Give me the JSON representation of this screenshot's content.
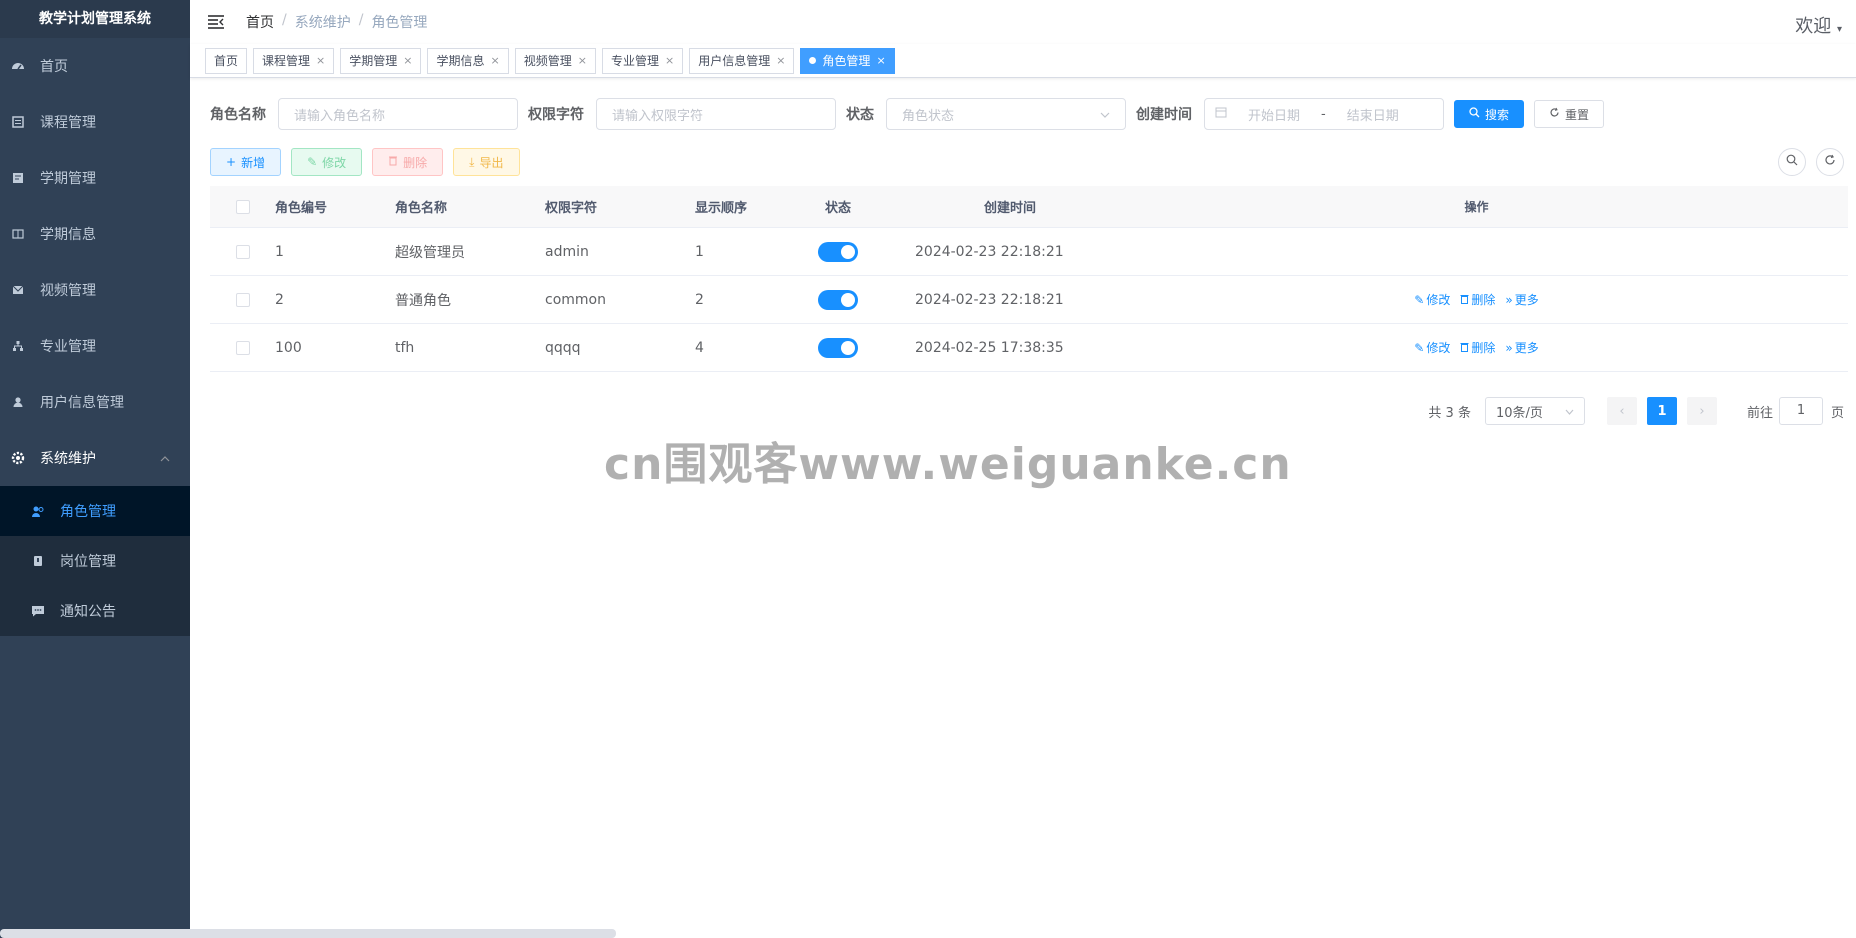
{
  "app": {
    "title": "教学计划管理系统"
  },
  "sidebar": {
    "items": [
      {
        "label": "首页",
        "icon": "dashboard-icon"
      },
      {
        "label": "课程管理",
        "icon": "list-icon"
      },
      {
        "label": "学期管理",
        "icon": "form-icon"
      },
      {
        "label": "学期信息",
        "icon": "table-icon"
      },
      {
        "label": "视频管理",
        "icon": "mail-icon"
      },
      {
        "label": "专业管理",
        "icon": "tree-icon"
      },
      {
        "label": "用户信息管理",
        "icon": "user-icon"
      },
      {
        "label": "系统维护",
        "icon": "gear-icon"
      }
    ],
    "submenu": [
      {
        "label": "角色管理",
        "icon": "peoples-icon"
      },
      {
        "label": "岗位管理",
        "icon": "post-icon"
      },
      {
        "label": "通知公告",
        "icon": "message-icon"
      }
    ]
  },
  "navbar": {
    "breadcrumb": [
      "首页",
      "系统维护",
      "角色管理"
    ],
    "separator": "/",
    "welcome": "欢迎"
  },
  "tags": [
    "首页",
    "课程管理",
    "学期管理",
    "学期信息",
    "视频管理",
    "专业管理",
    "用户信息管理",
    "角色管理"
  ],
  "search": {
    "role_name_label": "角色名称",
    "role_name_placeholder": "请输入角色名称",
    "role_key_label": "权限字符",
    "role_key_placeholder": "请输入权限字符",
    "status_label": "状态",
    "status_placeholder": "角色状态",
    "created_label": "创建时间",
    "start_placeholder": "开始日期",
    "range_sep": "-",
    "end_placeholder": "结束日期",
    "search_button": "搜索",
    "reset_button": "重置"
  },
  "toolbar": {
    "add": "新增",
    "edit": "修改",
    "delete": "删除",
    "export": "导出"
  },
  "table": {
    "headers": [
      "角色编号",
      "角色名称",
      "权限字符",
      "显示顺序",
      "状态",
      "创建时间",
      "操作"
    ],
    "rows": [
      {
        "id": "1",
        "name": "超级管理员",
        "key": "admin",
        "sort": "1",
        "status_on": true,
        "created": "2024-02-23 22:18:21",
        "ops": false
      },
      {
        "id": "2",
        "name": "普通角色",
        "key": "common",
        "sort": "2",
        "status_on": true,
        "created": "2024-02-23 22:18:21",
        "ops": true
      },
      {
        "id": "100",
        "name": "tfh",
        "key": "qqqq",
        "sort": "4",
        "status_on": true,
        "created": "2024-02-25 17:38:35",
        "ops": true
      }
    ],
    "op_labels": {
      "edit": "修改",
      "delete": "删除",
      "more": "更多"
    }
  },
  "pagination": {
    "total": "共 3 条",
    "page_size": "10条/页",
    "current": "1",
    "goto_label": "前往",
    "goto_value": "1",
    "page_unit": "页"
  },
  "watermark": "cn围观客www.weiguanke.cn",
  "colors": {
    "sidebar_bg": "#304156",
    "primary": "#1890ff",
    "active_menu_bg": "#001528"
  }
}
